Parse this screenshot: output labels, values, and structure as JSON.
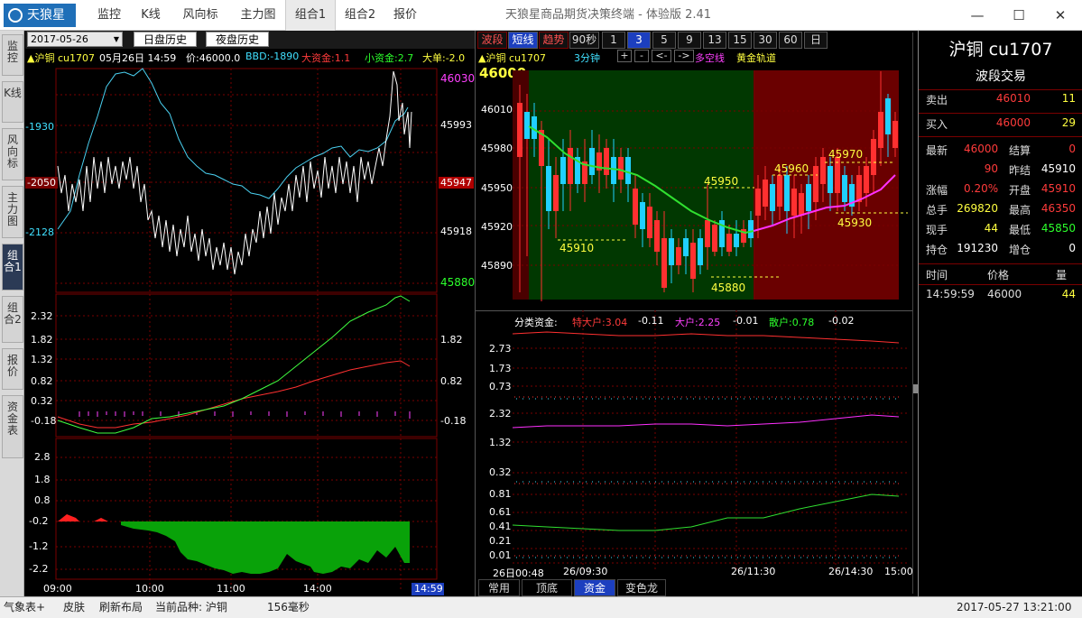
{
  "app": {
    "logo": "天狼星",
    "title": "天狼星商品期货决策终端 - 体验版 2.41",
    "menu": [
      "监控",
      "K线",
      "风向标",
      "主力图",
      "组合1",
      "组合2",
      "报价"
    ],
    "win": {
      "min": "—",
      "max": "☐",
      "close": "✕"
    }
  },
  "left_tabs": [
    "监控",
    "K线",
    "风向标",
    "主力图",
    "组合1",
    "组合2",
    "报价",
    "资金表"
  ],
  "left_panel": {
    "date": "2017-05-26",
    "day_btn": "日盘历史",
    "night_btn": "夜盘历史",
    "info": {
      "name": "▲沪铜 cu1707",
      "date": "05月26日 14:59",
      "price": "价:46000.0",
      "bbd": "BBD:-1890",
      "big_fund": "大资金:1.1",
      "small_fund": "小资金:2.7",
      "big_order": "大单:-2.0"
    },
    "left_axis": [
      "-1930",
      "-2050",
      "-2128"
    ],
    "right_axis": [
      "46030",
      "45993",
      "45947",
      "45918",
      "45880"
    ],
    "ind_left": [
      "2.32",
      "1.82",
      "1.32",
      "0.82",
      "0.32",
      "-0.18"
    ],
    "ind_right": [
      "1.82",
      "0.82",
      "-0.18"
    ],
    "bot_left": [
      "2.8",
      "1.8",
      "0.8",
      "-0.2",
      "-1.2",
      "-2.2"
    ],
    "time_axis": [
      "09:00",
      "10:00",
      "11:00",
      "14:00"
    ],
    "cur_time": "14:59"
  },
  "right_chart": {
    "period_buttons": [
      "波段",
      "短线",
      "趋势",
      "90秒",
      "1",
      "3",
      "5",
      "9",
      "13",
      "15",
      "30",
      "60",
      "日"
    ],
    "active_period": "3",
    "info": {
      "name": "▲沪铜 cu1707",
      "period": "3分钟",
      "multi": "多空线",
      "gold": "黄金轨道"
    },
    "sub_btns": [
      "+",
      "-",
      "<-",
      "->"
    ],
    "price_now": "46000",
    "price_axis": [
      "46010",
      "45980",
      "45950",
      "45920",
      "45890"
    ],
    "annotations": [
      "45910",
      "45950",
      "45960",
      "45970",
      "45930",
      "45880"
    ],
    "fund_header": {
      "label": "分类资金:",
      "special": "特大户:3.04",
      "special_chg": "-0.11",
      "big": "大户:2.25",
      "big_chg": "-0.01",
      "retail": "散户:0.78",
      "retail_chg": "-0.02"
    },
    "f1_axis": [
      "2.73",
      "1.73",
      "0.73"
    ],
    "f2_axis": [
      "2.32",
      "1.32",
      "0.32"
    ],
    "f3_axis": [
      "0.81",
      "0.61",
      "0.41",
      "0.21",
      "0.01"
    ],
    "time_axis": [
      "26日00:48",
      "26/09:30",
      "26/11:30",
      "26/14:30",
      "15:00"
    ],
    "bottom_tabs": [
      "常用",
      "顶底",
      "资金",
      "变色龙"
    ],
    "active_tab": "资金"
  },
  "quote": {
    "title": "沪铜 cu1707",
    "subtitle": "波段交易",
    "sell": {
      "label": "卖出",
      "price": "46010",
      "vol": "11"
    },
    "buy": {
      "label": "买入",
      "price": "46000",
      "vol": "29"
    },
    "rows": [
      {
        "l1": "最新",
        "v1": "46000",
        "c1": "red",
        "l2": "结算",
        "v2": "0",
        "c2": "red"
      },
      {
        "l1": "",
        "v1": "90",
        "c1": "red",
        "l2": "昨结",
        "v2": "45910",
        "c2": "wht"
      },
      {
        "l1": "涨幅",
        "v1": "0.20%",
        "c1": "red",
        "l2": "开盘",
        "v2": "45910",
        "c2": "red"
      },
      {
        "l1": "总手",
        "v1": "269820",
        "c1": "yel",
        "l2": "最高",
        "v2": "46350",
        "c2": "red"
      },
      {
        "l1": "现手",
        "v1": "44",
        "c1": "yel",
        "l2": "最低",
        "v2": "45850",
        "c2": "grn"
      },
      {
        "l1": "持仓",
        "v1": "191230",
        "c1": "wht",
        "l2": "增仓",
        "v2": "0",
        "c2": "wht"
      }
    ],
    "trade_header": [
      "时间",
      "价格",
      "量"
    ],
    "trades": [
      {
        "time": "14:59:59",
        "price": "46000",
        "vol": "44"
      }
    ]
  },
  "statusbar": {
    "items": [
      "气象表+",
      "皮肤",
      "刷新布局",
      "当前品种: 沪铜",
      "156毫秒"
    ],
    "datetime": "2017-05-27 13:21:00"
  }
}
